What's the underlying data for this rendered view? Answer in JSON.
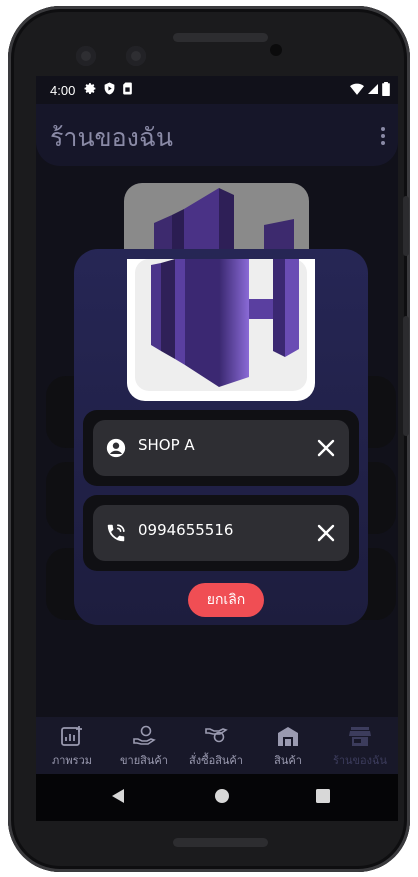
{
  "status": {
    "time": "4:00"
  },
  "app": {
    "title": "ร้านของฉัน"
  },
  "dialog": {
    "shop_name": {
      "value": "SHOP A",
      "icon": "user-circle-icon"
    },
    "phone": {
      "value": "0994655516",
      "icon": "phone-icon"
    },
    "cancel_label": "ยกเลิก"
  },
  "nav": {
    "items": [
      {
        "label": "ภาพรวม",
        "icon": "chart-icon",
        "active": false
      },
      {
        "label": "ขายสินค้า",
        "icon": "sell-hand-icon",
        "active": false
      },
      {
        "label": "สั่งซื้อสินค้า",
        "icon": "order-hand-icon",
        "active": false
      },
      {
        "label": "สินค้า",
        "icon": "warehouse-icon",
        "active": false
      },
      {
        "label": "ร้านของฉัน",
        "icon": "store-icon",
        "active": true
      }
    ]
  },
  "colors": {
    "accent": "#f04e54",
    "dialog_bg": "#262655",
    "appbar_bg": "#161629",
    "logo_purple": "#5b3a9e"
  }
}
